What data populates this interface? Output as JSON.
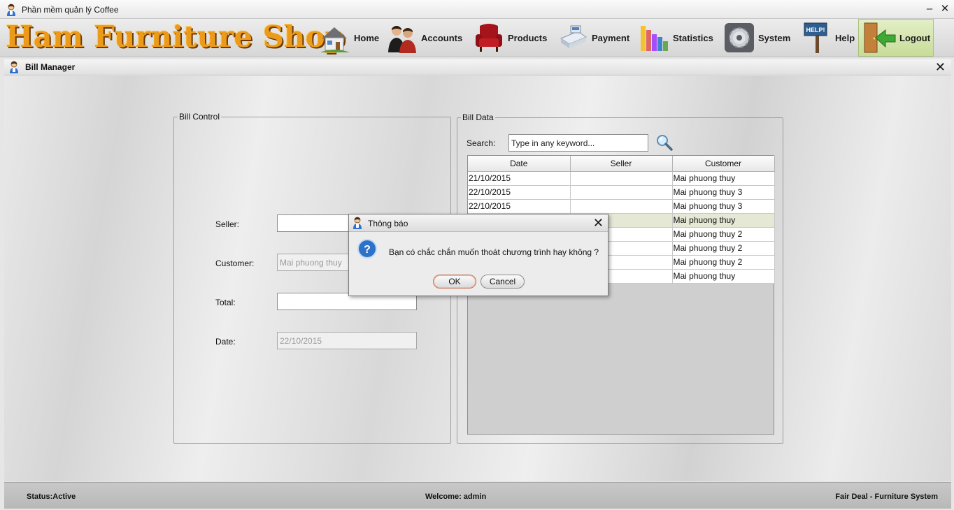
{
  "window": {
    "title": "Phần mềm quản lý Coffee",
    "minimize": "–",
    "close": "✕"
  },
  "toolbar": {
    "logo_text": "Ham Furniture Shop",
    "items": [
      {
        "label": "Home",
        "icon": "house-icon"
      },
      {
        "label": "Accounts",
        "icon": "people-icon"
      },
      {
        "label": "Products",
        "icon": "armchair-icon"
      },
      {
        "label": "Payment",
        "icon": "cash-register-icon"
      },
      {
        "label": "Statistics",
        "icon": "bar-chart-icon"
      },
      {
        "label": "System",
        "icon": "gear-icon"
      },
      {
        "label": "Help",
        "icon": "help-sign-icon",
        "sign_text": "HELP!"
      },
      {
        "label": "Logout",
        "icon": "logout-door-icon",
        "active": true
      }
    ]
  },
  "frame": {
    "title": "Bill Manager",
    "close": "✕"
  },
  "bill_control": {
    "legend": "Bill Control",
    "seller_label": "Seller:",
    "seller_value": "",
    "customer_label": "Customer:",
    "customer_value": "Mai phuong thuy",
    "total_label": "Total:",
    "total_value": "",
    "date_label": "Date:",
    "date_value": "22/10/2015"
  },
  "bill_data": {
    "legend": "Bill Data",
    "search_label": "Search:",
    "search_value": "Type in any keyword...",
    "columns": [
      "Date",
      "Seller",
      "Customer"
    ],
    "rows": [
      [
        "21/10/2015",
        "",
        "Mai phuong thuy"
      ],
      [
        "22/10/2015",
        "",
        "Mai phuong thuy 3"
      ],
      [
        "22/10/2015",
        "",
        "Mai phuong thuy 3"
      ],
      [
        "",
        "",
        "Mai phuong thuy"
      ],
      [
        "",
        "",
        "Mai phuong thuy 2"
      ],
      [
        "",
        "",
        "Mai phuong thuy 2"
      ],
      [
        "",
        "",
        "Mai phuong thuy 2"
      ],
      [
        "",
        "",
        "Mai phuong thuy"
      ]
    ],
    "selected_row": 3
  },
  "status": {
    "left": "Status:Active",
    "center": "Welcome: admin",
    "right": "Fair Deal - Furniture System"
  },
  "dialog": {
    "title": "Thông báo",
    "message": "Bạn có chắc chắn muốn thoát chương trình hay không ?",
    "ok": "OK",
    "cancel": "Cancel",
    "close": "✕"
  },
  "colors": {
    "logo": "#ec9a1a",
    "active_nav": "#c8dc98",
    "selected_row": "#e4e8d4",
    "status_bar": "#c0c0c0"
  }
}
